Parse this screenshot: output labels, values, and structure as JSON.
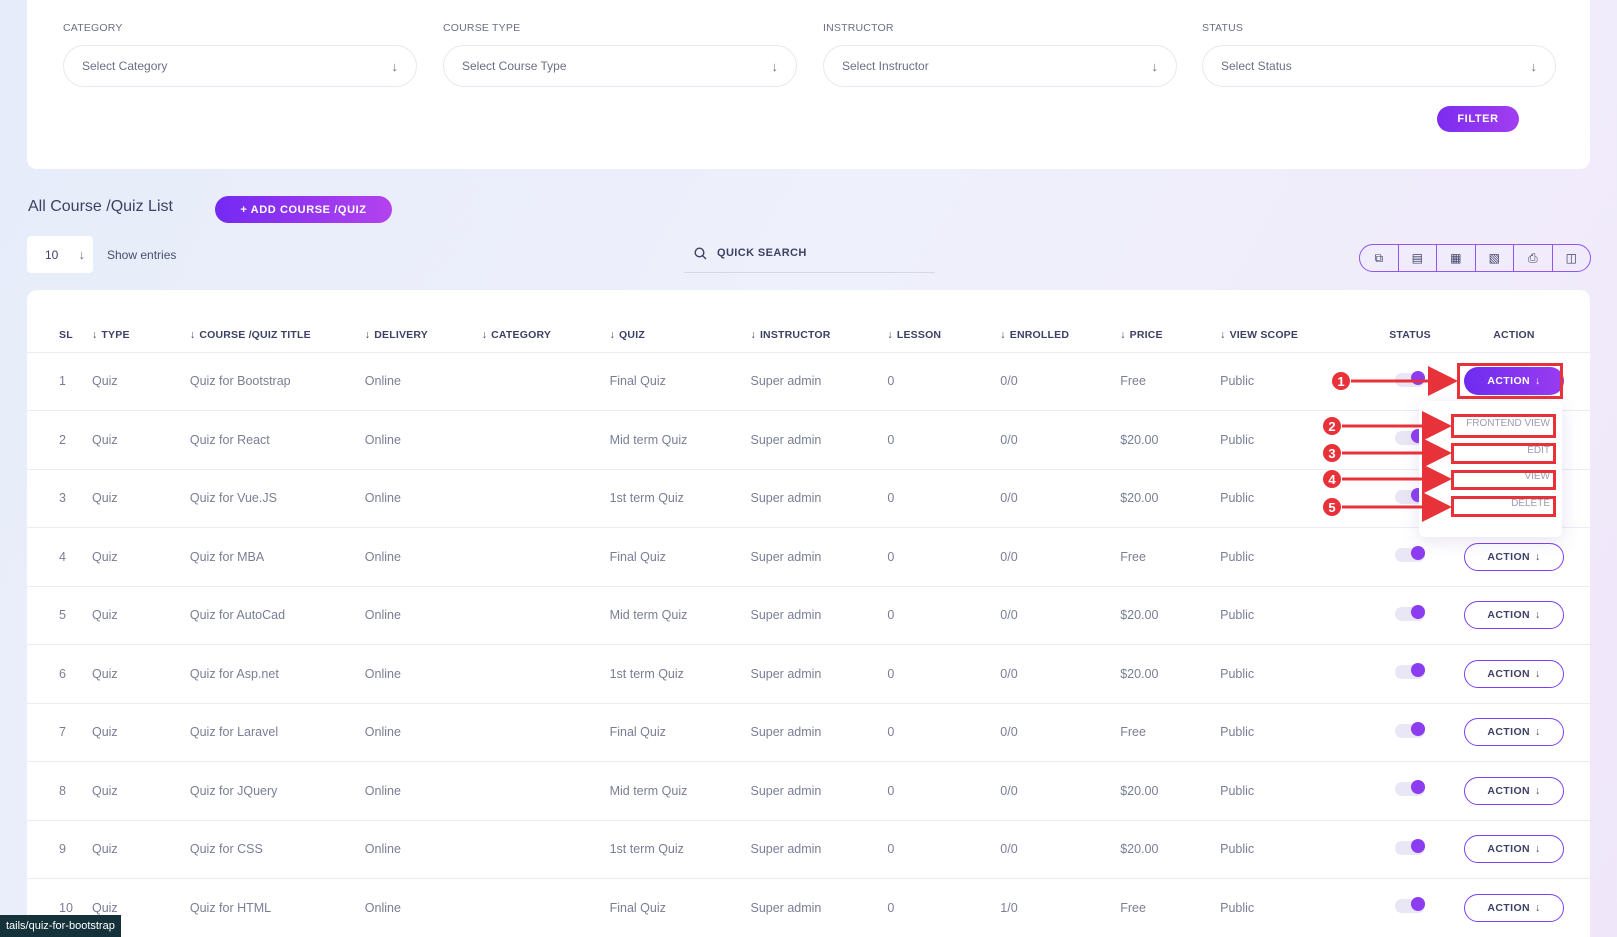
{
  "filters": [
    {
      "label": "CATEGORY",
      "placeholder": "Select Category"
    },
    {
      "label": "COURSE TYPE",
      "placeholder": "Select Course Type"
    },
    {
      "label": "INSTRUCTOR",
      "placeholder": "Select Instructor"
    },
    {
      "label": "STATUS",
      "placeholder": "Select Status"
    }
  ],
  "filter_button": "FILTER",
  "list_title": "All Course /Quiz List",
  "add_button": "+ ADD COURSE /QUIZ",
  "entries": {
    "value": "10",
    "label": "Show entries"
  },
  "search": {
    "placeholder": "QUICK SEARCH"
  },
  "export_icons": [
    "copy-icon",
    "excel-icon",
    "csv-icon",
    "pdf-icon",
    "print-icon",
    "columns-icon"
  ],
  "columns": [
    "SL",
    "TYPE",
    "COURSE /QUIZ TITLE",
    "DELIVERY",
    "CATEGORY",
    "QUIZ",
    "INSTRUCTOR",
    "LESSON",
    "ENROLLED",
    "PRICE",
    "VIEW SCOPE",
    "STATUS",
    "ACTION"
  ],
  "rows": [
    {
      "sl": "1",
      "type": "Quiz",
      "title": "Quiz for Bootstrap",
      "delivery": "Online",
      "category": "",
      "quiz": "Final Quiz",
      "instructor": "Super admin",
      "lesson": "0",
      "enrolled": "0/0",
      "price": "Free",
      "scope": "Public",
      "status_on": true
    },
    {
      "sl": "2",
      "type": "Quiz",
      "title": "Quiz for React",
      "delivery": "Online",
      "category": "",
      "quiz": "Mid term Quiz",
      "instructor": "Super admin",
      "lesson": "0",
      "enrolled": "0/0",
      "price": "$20.00",
      "scope": "Public",
      "status_on": true
    },
    {
      "sl": "3",
      "type": "Quiz",
      "title": "Quiz for Vue.JS",
      "delivery": "Online",
      "category": "",
      "quiz": "1st term Quiz",
      "instructor": "Super admin",
      "lesson": "0",
      "enrolled": "0/0",
      "price": "$20.00",
      "scope": "Public",
      "status_on": true
    },
    {
      "sl": "4",
      "type": "Quiz",
      "title": "Quiz for MBA",
      "delivery": "Online",
      "category": "",
      "quiz": "Final Quiz",
      "instructor": "Super admin",
      "lesson": "0",
      "enrolled": "0/0",
      "price": "Free",
      "scope": "Public",
      "status_on": true
    },
    {
      "sl": "5",
      "type": "Quiz",
      "title": "Quiz for AutoCad",
      "delivery": "Online",
      "category": "",
      "quiz": "Mid term Quiz",
      "instructor": "Super admin",
      "lesson": "0",
      "enrolled": "0/0",
      "price": "$20.00",
      "scope": "Public",
      "status_on": true
    },
    {
      "sl": "6",
      "type": "Quiz",
      "title": "Quiz for Asp.net",
      "delivery": "Online",
      "category": "",
      "quiz": "1st term Quiz",
      "instructor": "Super admin",
      "lesson": "0",
      "enrolled": "0/0",
      "price": "$20.00",
      "scope": "Public",
      "status_on": true
    },
    {
      "sl": "7",
      "type": "Quiz",
      "title": "Quiz for Laravel",
      "delivery": "Online",
      "category": "",
      "quiz": "Final Quiz",
      "instructor": "Super admin",
      "lesson": "0",
      "enrolled": "0/0",
      "price": "Free",
      "scope": "Public",
      "status_on": true
    },
    {
      "sl": "8",
      "type": "Quiz",
      "title": "Quiz for JQuery",
      "delivery": "Online",
      "category": "",
      "quiz": "Mid term Quiz",
      "instructor": "Super admin",
      "lesson": "0",
      "enrolled": "0/0",
      "price": "$20.00",
      "scope": "Public",
      "status_on": true
    },
    {
      "sl": "9",
      "type": "Quiz",
      "title": "Quiz for CSS",
      "delivery": "Online",
      "category": "",
      "quiz": "1st term Quiz",
      "instructor": "Super admin",
      "lesson": "0",
      "enrolled": "0/0",
      "price": "$20.00",
      "scope": "Public",
      "status_on": true
    },
    {
      "sl": "10",
      "type": "Quiz",
      "title": "Quiz for HTML",
      "delivery": "Online",
      "category": "",
      "quiz": "Final Quiz",
      "instructor": "Super admin",
      "lesson": "0",
      "enrolled": "1/0",
      "price": "Free",
      "scope": "Public",
      "status_on": true
    }
  ],
  "action_label": "ACTION",
  "action_menu": [
    "FRONTEND VIEW",
    "EDIT",
    "VIEW",
    "DELETE"
  ],
  "callouts": [
    "1",
    "2",
    "3",
    "4",
    "5"
  ],
  "status_url": "tails/quiz-for-bootstrap",
  "colors": {
    "accent": "#7c2cf0",
    "accent_light": "#a23ef0",
    "callout_red": "#e8323a"
  }
}
